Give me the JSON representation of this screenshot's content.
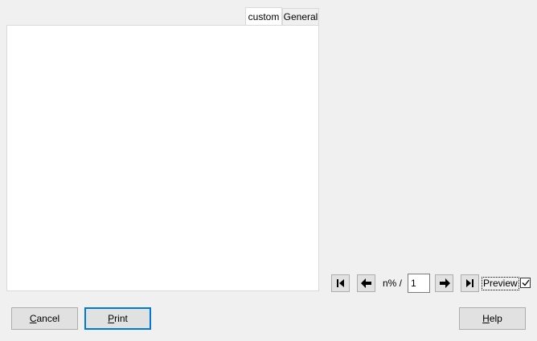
{
  "tabs": [
    {
      "label": "custom",
      "active": true
    },
    {
      "label": "General",
      "active": false
    }
  ],
  "navigation": {
    "first_icon": "skip-first-icon",
    "prev_icon": "arrow-left-icon",
    "next_icon": "arrow-right-icon",
    "last_icon": "skip-last-icon",
    "page_label": "n% /",
    "page_value": "1"
  },
  "preview": {
    "label": "Preview",
    "checked": true
  },
  "buttons": {
    "cancel": {
      "mnemonic": "C",
      "rest": "ancel"
    },
    "print": {
      "mnemonic": "P",
      "rest": "rint"
    },
    "help": {
      "mnemonic": "H",
      "rest": "elp"
    }
  },
  "colors": {
    "background": "#f0f0f0",
    "panel": "#ffffff",
    "button_face": "#e1e1e1",
    "default_button_border": "#0078d7"
  }
}
